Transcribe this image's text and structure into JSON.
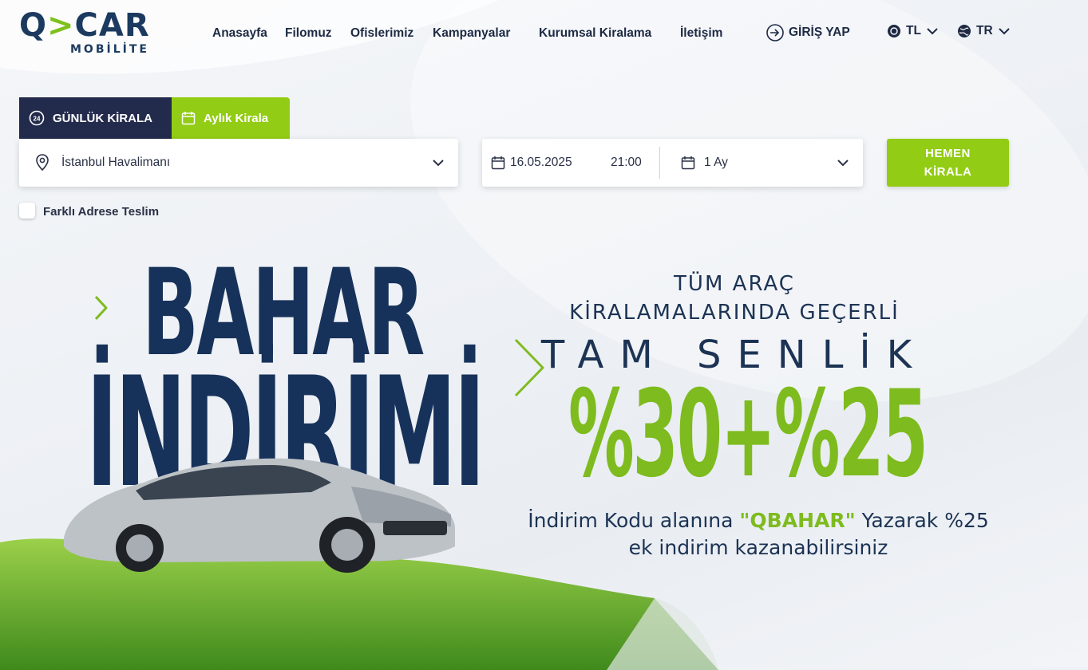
{
  "brand": {
    "logo_main_left": "Q",
    "logo_main_right": "CAR",
    "logo_sub": "MOBİLİTE"
  },
  "nav": [
    {
      "label": "Anasayfa"
    },
    {
      "label": "Filomuz"
    },
    {
      "label": "Ofislerimiz"
    },
    {
      "label": "Kampanyalar"
    },
    {
      "label": "Kurumsal Kiralama"
    },
    {
      "label": "İletişim"
    }
  ],
  "header": {
    "login_label": "GİRİŞ YAP",
    "currency": "TL",
    "language": "TR"
  },
  "tabs": {
    "daily": "GÜNLÜK KİRALA",
    "monthly": "Aylık Kirala"
  },
  "search": {
    "location": "İstanbul Havalimanı",
    "date": "16.05.2025",
    "time": "21:00",
    "duration": "1 Ay",
    "cta_line1": "HEMEN",
    "cta_line2": "KİRALA",
    "different_address_label": "Farklı Adrese Teslim"
  },
  "banner": {
    "title_line1": "BAHAR",
    "title_line2": "İNDİRİMİ",
    "promo_line1": "TÜM ARAÇ",
    "promo_line2": "KİRALAMALARINDA GEÇERLİ",
    "promo_line3": "TAM SENLİK",
    "discount": "%30+%25",
    "code_text_before": "İndirim Kodu alanına",
    "code": "\"QBAHAR\"",
    "code_text_after": "Yazarak %25",
    "code_text_line2": "ek indirim kazanabilirsiniz"
  },
  "colors": {
    "navy": "#232b4c",
    "green": "#92cc14",
    "title": "#17325a",
    "discount": "#7ebb1e"
  }
}
